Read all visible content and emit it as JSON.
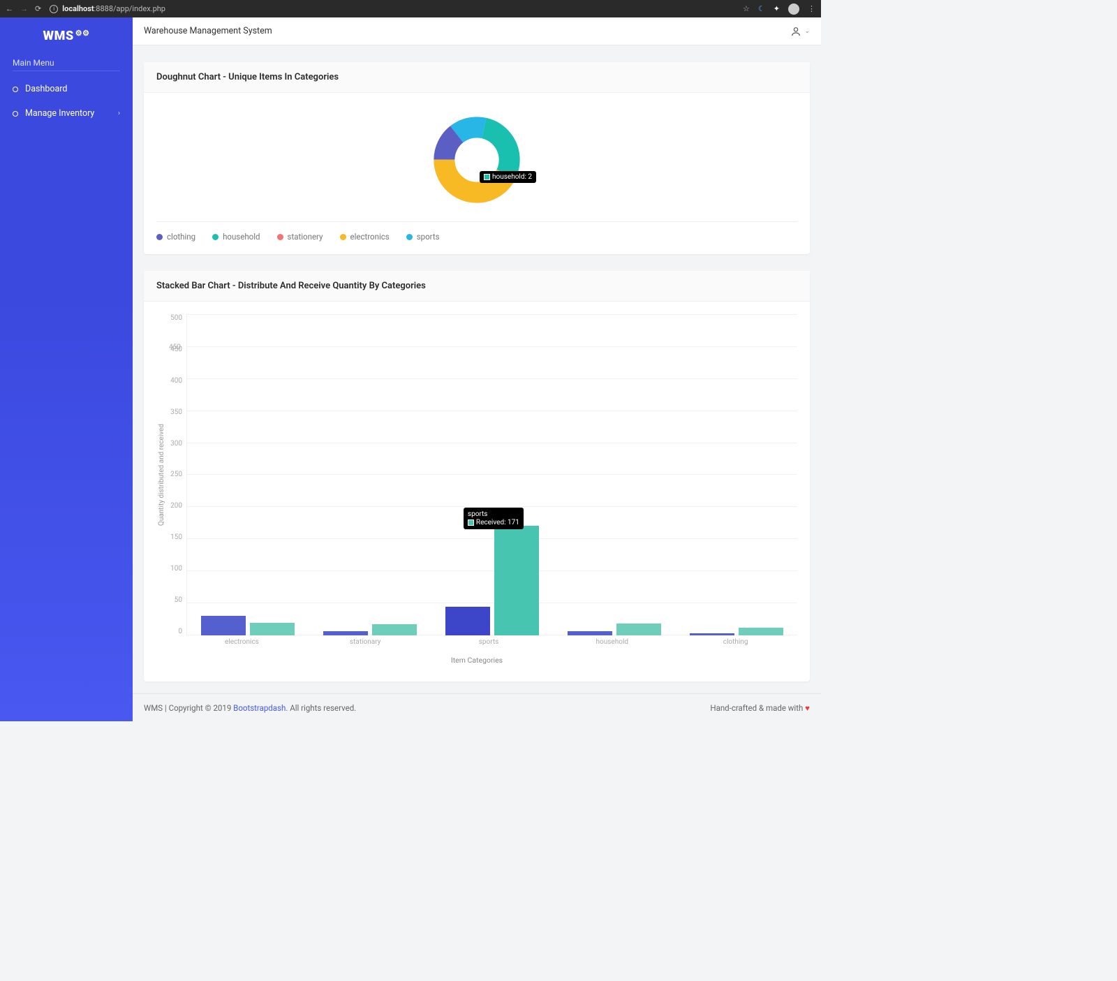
{
  "browser": {
    "url_host": "localhost",
    "url_path": ":8888/app/index.php"
  },
  "sidebar": {
    "logo": "WMS",
    "menu_header": "Main Menu",
    "items": [
      {
        "label": "Dashboard",
        "has_children": false
      },
      {
        "label": "Manage Inventory",
        "has_children": true
      }
    ]
  },
  "header": {
    "title": "Warehouse Management System"
  },
  "doughnut_card": {
    "title": "Doughnut Chart - Unique Items In Categories",
    "tooltip": {
      "label": "household: 2",
      "swatch_color": "#19c0af"
    },
    "legend": [
      {
        "label": "clothing",
        "color": "#5b5fc4"
      },
      {
        "label": "household",
        "color": "#19c0af"
      },
      {
        "label": "stationery",
        "color": "#f57272"
      },
      {
        "label": "electronics",
        "color": "#f7b924"
      },
      {
        "label": "sports",
        "color": "#28b6e6"
      }
    ]
  },
  "bar_card": {
    "title": "Stacked Bar Chart - Distribute And Receive Quantity By Categories",
    "tooltip": {
      "category": "sports",
      "value_label": "Received: 171",
      "swatch_color": "#47c5b0"
    },
    "y_title": "Quantity distributed and received",
    "x_title": "Item Categories",
    "y_ticks": [
      "500",
      "450",
      "400",
      "350",
      "300",
      "250",
      "200",
      "150",
      "100",
      "50",
      "0"
    ],
    "extra_tick": "450",
    "x_cats": [
      "electronics",
      "stationary",
      "sports",
      "household",
      "clothing"
    ]
  },
  "footer": {
    "left_pre": "WMS | Copyright © 2019 ",
    "link": "Bootstrapdash",
    "left_post": ". All rights reserved.",
    "right_pre": "Hand-crafted & made with "
  },
  "chart_data": [
    {
      "type": "pie",
      "title": "Doughnut Chart - Unique Items In Categories",
      "series": [
        {
          "name": "clothing",
          "value": 1,
          "color": "#5b5fc4"
        },
        {
          "name": "sports",
          "value": 1,
          "color": "#28b6e6"
        },
        {
          "name": "household",
          "value": 2,
          "color": "#19c0af"
        },
        {
          "name": "electronics",
          "value": 3,
          "color": "#f7b924"
        },
        {
          "name": "stationery",
          "value": 0,
          "color": "#f57272"
        }
      ],
      "doughnut": true
    },
    {
      "type": "bar",
      "title": "Stacked Bar Chart - Distribute And Receive Quantity By Categories",
      "xlabel": "Item Categories",
      "ylabel": "Quantity distributed and received",
      "ylim": [
        0,
        500
      ],
      "categories": [
        "electronics",
        "stationary",
        "sports",
        "household",
        "clothing"
      ],
      "series": [
        {
          "name": "Distributed",
          "color": "#5560cf",
          "values": [
            30,
            6,
            45,
            6,
            3
          ]
        },
        {
          "name": "Received",
          "color": "#47c5b0",
          "values": [
            20,
            17,
            171,
            19,
            12
          ]
        }
      ]
    }
  ]
}
